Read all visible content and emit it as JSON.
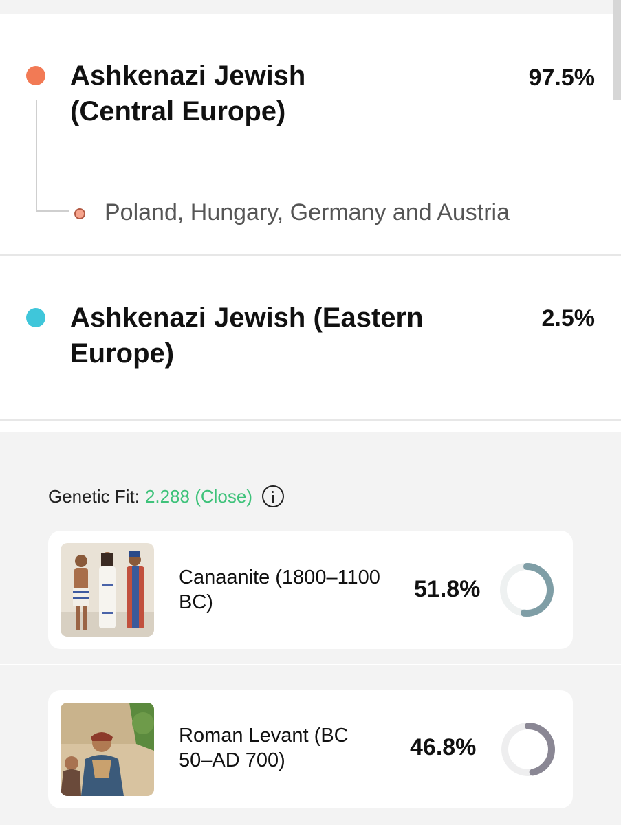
{
  "ancestry": [
    {
      "title": "Ashkenazi Jewish (Central Europe)",
      "title_line1": "Ashkenazi Jewish",
      "title_line2": "(Central Europe)",
      "percent": "97.5%",
      "color": "#f27a55",
      "subregion": "Poland, Hungary, Germany and Austria"
    },
    {
      "title": "Ashkenazi Jewish (Eastern Europe)",
      "title_line1": "Ashkenazi Jewish (Eastern",
      "title_line2": "Europe)",
      "percent": "2.5%",
      "color": "#3fc6da"
    }
  ],
  "genetic_fit": {
    "label": "Genetic Fit:",
    "value": "2.288 (Close)",
    "value_color": "#3ec27a",
    "icon": "info-icon"
  },
  "populations": [
    {
      "line1": "Canaanite (1800–1100",
      "line2": "BC)",
      "percent": "51.8%",
      "fraction": 0.518,
      "ring_color": "#7f9ea6",
      "thumbnail": "canaanite-figures-illustration"
    },
    {
      "line1": "Roman Levant (BC",
      "line2": "50–AD 700)",
      "percent": "46.8%",
      "fraction": 0.468,
      "ring_color": "#8a8794",
      "thumbnail": "roman-levant-painting"
    }
  ]
}
